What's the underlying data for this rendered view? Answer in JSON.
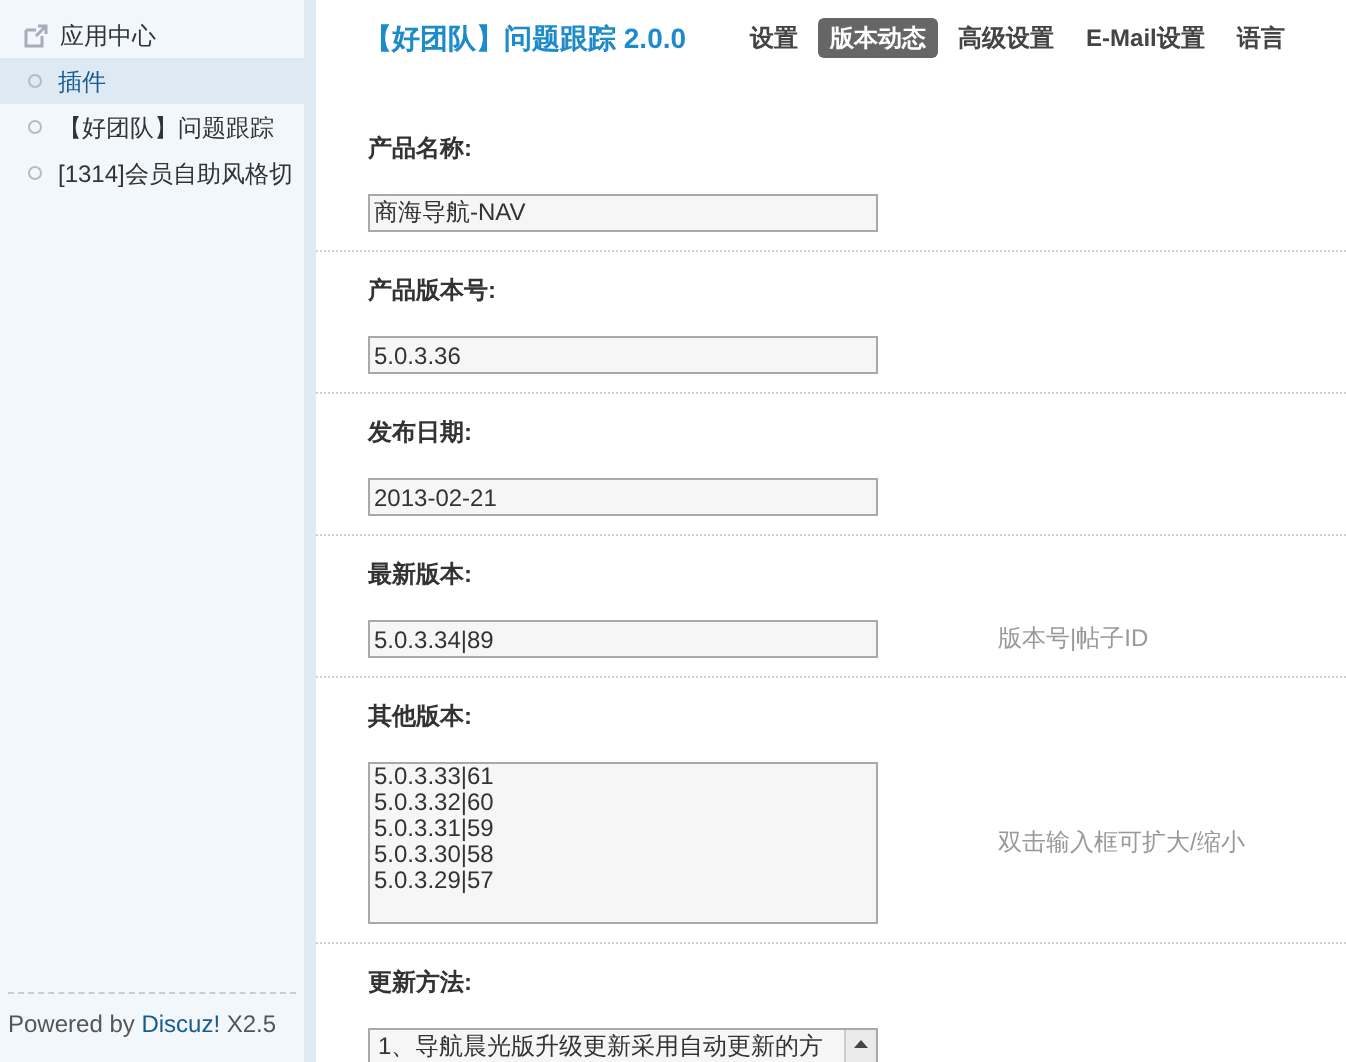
{
  "sidebar": {
    "items": [
      {
        "kind": "link",
        "label": "应用中心",
        "selected": false
      },
      {
        "kind": "item",
        "label": "插件",
        "selected": true
      },
      {
        "kind": "item",
        "label": "【好团队】问题跟踪",
        "selected": false
      },
      {
        "kind": "item",
        "label": "[1314]会员自助风格切",
        "selected": false
      }
    ],
    "footer": {
      "text": "Powered by ",
      "link": "Discuz!",
      "version": " X2.5"
    }
  },
  "header": {
    "title": "【好团队】问题跟踪 2.0.0",
    "tabs": [
      {
        "label": "设置",
        "selected": false
      },
      {
        "label": "版本动态",
        "selected": true
      },
      {
        "label": "高级设置",
        "selected": false
      },
      {
        "label": "E-Mail设置",
        "selected": false
      },
      {
        "label": "语言",
        "selected": false
      }
    ]
  },
  "fields": [
    {
      "kind": "input",
      "label": "产品名称:",
      "value": "商海导航-NAV"
    },
    {
      "kind": "input",
      "label": "产品版本号:",
      "value": "5.0.3.36"
    },
    {
      "kind": "input",
      "label": "发布日期:",
      "value": "2013-02-21"
    },
    {
      "kind": "input",
      "label": "最新版本:",
      "value": "5.0.3.34|89",
      "hint": "版本号|帖子ID"
    },
    {
      "kind": "textarea",
      "label": "其他版本:",
      "value": "5.0.3.33|61\n5.0.3.32|60\n5.0.3.31|59\n5.0.3.30|58\n5.0.3.29|57",
      "hint": "双击输入框可扩大/缩小"
    },
    {
      "kind": "scrollbox",
      "label": "更新方法:",
      "value": "1、导航晨光版升级更新采用自动更新的方"
    }
  ]
}
